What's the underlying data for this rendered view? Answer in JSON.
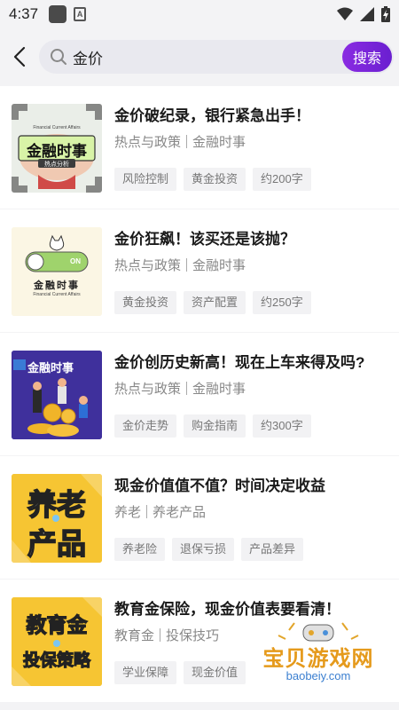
{
  "status": {
    "time": "4:37"
  },
  "search": {
    "query": "金价",
    "button_label": "搜索"
  },
  "results": [
    {
      "title": "金价破纪录，银行紧急出手！",
      "categories": [
        "热点与政策",
        "金融时事"
      ],
      "tags": [
        "风险控制",
        "黄金投资",
        "约200字"
      ],
      "thumb": {
        "main": "金融时事",
        "sub": "热点分析",
        "top": "Financial Current Affairs"
      }
    },
    {
      "title": "金价狂飙！该买还是该抛？",
      "categories": [
        "热点与政策",
        "金融时事"
      ],
      "tags": [
        "黄金投资",
        "资产配置",
        "约250字"
      ],
      "thumb": {
        "main": "金融时事",
        "toggle": "ON",
        "sub": "Financial Current Affairs"
      }
    },
    {
      "title": "金价创历史新高！现在上车来得及吗?",
      "categories": [
        "热点与政策",
        "金融时事"
      ],
      "tags": [
        "金价走势",
        "购金指南",
        "约300字"
      ],
      "thumb": {
        "main": "金融时事"
      }
    },
    {
      "title": "现金价值值不值？时间决定收益",
      "categories": [
        "养老",
        "养老产品"
      ],
      "tags": [
        "养老险",
        "退保亏损",
        "产品差异"
      ],
      "thumb": {
        "line1": "养老",
        "line2": "产品"
      }
    },
    {
      "title": "教育金保险，现金价值表要看清！",
      "categories": [
        "教育金",
        "投保技巧"
      ],
      "tags": [
        "学业保障",
        "现金价值"
      ],
      "thumb": {
        "line1": "教育金",
        "line2": "投保策略"
      }
    }
  ],
  "watermark": {
    "title": "宝贝游戏网",
    "url": "baobeiy.com"
  },
  "colors": {
    "accent": "#7a25d9",
    "tag_bg": "#f2f2f4"
  }
}
